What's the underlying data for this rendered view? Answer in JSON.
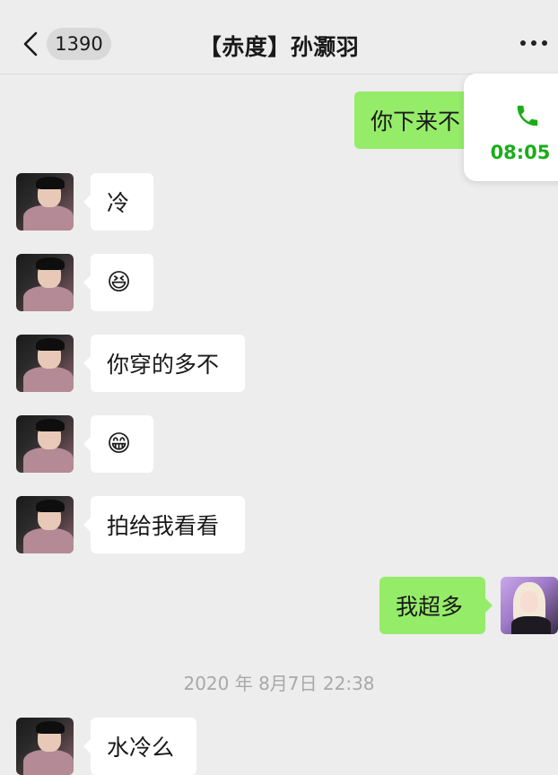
{
  "header": {
    "back_icon": "chevron-left-icon",
    "unread_count": "1390",
    "title": "【赤度】孙灏羽",
    "more_icon": "ellipsis-icon"
  },
  "call_float": {
    "icon": "phone-icon",
    "duration": "08:05",
    "accent": "#1aad19"
  },
  "messages": [
    {
      "side": "out",
      "text": "你下来不"
    },
    {
      "side": "in",
      "text": "冷"
    },
    {
      "side": "in",
      "text": "😆"
    },
    {
      "side": "in",
      "text": "你穿的多不"
    },
    {
      "side": "in",
      "text": "😁"
    },
    {
      "side": "in",
      "text": "拍给我看看"
    },
    {
      "side": "out",
      "text": "我超多"
    },
    {
      "side": "in",
      "text": "水冷么"
    }
  ],
  "timestamp": "2020 年 8月7日 22:38",
  "colors": {
    "background": "#ededed",
    "outgoing_bubble": "#95ec69",
    "incoming_bubble": "#ffffff"
  }
}
